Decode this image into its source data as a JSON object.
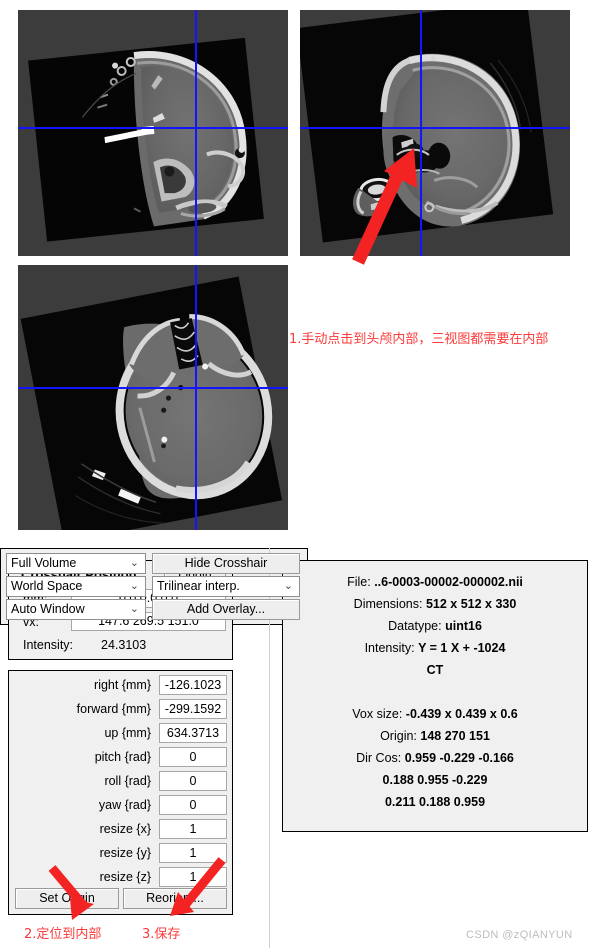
{
  "viewer": {
    "panels": [
      {
        "name": "coronal-view",
        "orientation": "coronal"
      },
      {
        "name": "sagittal-view",
        "orientation": "sagittal"
      },
      {
        "name": "axial-view",
        "orientation": "axial"
      }
    ],
    "crosshair_color": "#1414ff",
    "background_color": "#3c3c3c"
  },
  "annotations": {
    "step1": "1.手动点击到头颅内部，三视图都需要在内部",
    "step2": "2.定位到内部",
    "step3": "3.保存",
    "color": "#fb3a3a"
  },
  "watermark": "CSDN @zQIANYUN",
  "crosshair_panel": {
    "title": "Crosshair Position",
    "origin_button": "Origin",
    "mm_label": "mm:",
    "mm_value": "0.0 0.0 0.0",
    "vx_label": "vx:",
    "vx_value": "147.6 269.5 151.0",
    "intensity_label": "Intensity:",
    "intensity_value": "24.3103"
  },
  "transform_panel": {
    "fields": [
      {
        "label": "right  {mm}",
        "value": "-126.1023"
      },
      {
        "label": "forward  {mm}",
        "value": "-299.1592"
      },
      {
        "label": "up  {mm}",
        "value": "634.3713"
      },
      {
        "label": "pitch  {rad}",
        "value": "0"
      },
      {
        "label": "roll  {rad}",
        "value": "0"
      },
      {
        "label": "yaw  {rad}",
        "value": "0"
      },
      {
        "label": "resize  {x}",
        "value": "1"
      },
      {
        "label": "resize  {y}",
        "value": "1"
      },
      {
        "label": "resize  {z}",
        "value": "1"
      }
    ],
    "set_origin_button": "Set Origin",
    "reorient_button": "Reorient..."
  },
  "info_panel": {
    "lines": [
      {
        "key": "File:",
        "value": "..6-0003-00002-000002.nii"
      },
      {
        "key": "Dimensions:",
        "value": "512 x 512 x 330"
      },
      {
        "key": "Datatype:",
        "value": "uint16"
      },
      {
        "key": "Intensity:",
        "value": "Y = 1 X + -1024"
      },
      {
        "key": "",
        "value": "CT"
      },
      {
        "key": "",
        "value": ""
      },
      {
        "key": "Vox size:",
        "value": "-0.439 x 0.439 x 0.6"
      },
      {
        "key": "Origin:",
        "value": "148 270 151"
      },
      {
        "key": "Dir Cos:",
        "value": "0.959 -0.229 -0.166"
      },
      {
        "key": "",
        "value": "0.188  0.955 -0.229"
      },
      {
        "key": "",
        "value": "0.211  0.188  0.959"
      }
    ]
  },
  "options_panel": {
    "volume_select": "Full Volume",
    "space_select": "World Space",
    "window_select": "Auto Window",
    "hide_crosshair_button": "Hide Crosshair",
    "interp_select": "Trilinear interp.",
    "add_overlay_button": "Add Overlay...",
    "caret": "⌄"
  }
}
